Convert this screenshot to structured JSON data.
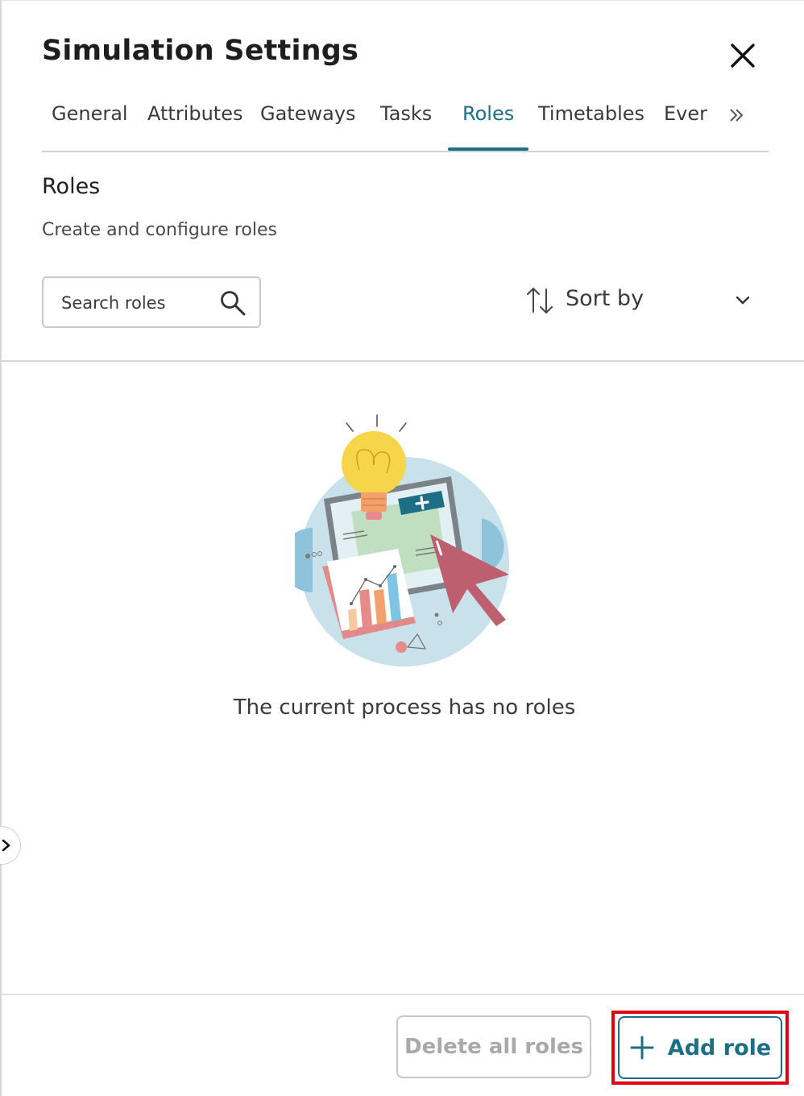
{
  "dialog": {
    "title": "Simulation Settings"
  },
  "tabs": [
    {
      "label": "General"
    },
    {
      "label": "Attributes"
    },
    {
      "label": "Gateways"
    },
    {
      "label": "Tasks"
    },
    {
      "label": "Roles",
      "active": true
    },
    {
      "label": "Timetables"
    },
    {
      "label": "Ever"
    }
  ],
  "section": {
    "title": "Roles",
    "subtitle": "Create and configure roles"
  },
  "search": {
    "placeholder": "Search roles",
    "value": ""
  },
  "sort": {
    "label": "Sort by"
  },
  "empty_state": {
    "message": "The current process has no roles"
  },
  "footer": {
    "delete_all_label": "Delete all roles",
    "add_label": "Add role"
  },
  "colors": {
    "accent": "#1d6f86",
    "highlight": "#e1000f",
    "disabled_text": "#a9a9a9"
  },
  "icons": [
    "close-icon",
    "chevron-double-right-icon",
    "search-icon",
    "sort-icon",
    "chevron-down-icon",
    "chevron-right-icon",
    "plus-icon"
  ]
}
